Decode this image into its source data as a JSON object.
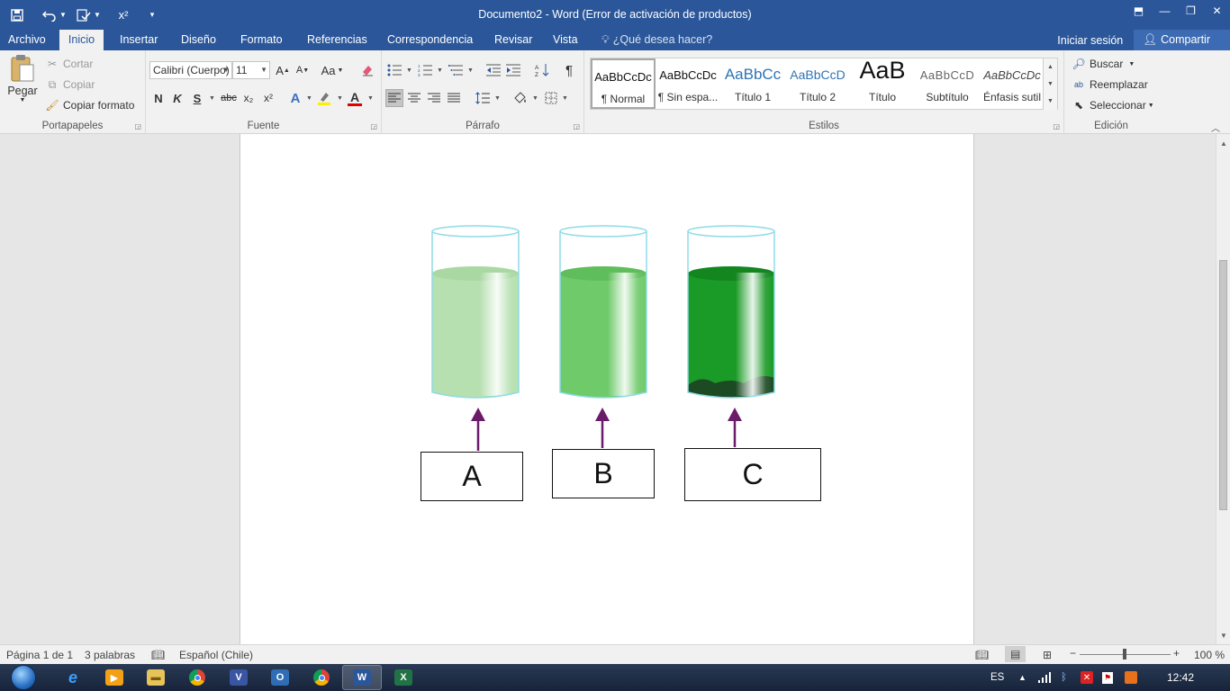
{
  "titlebar": {
    "title": "Documento2 - Word (Error de activación de productos)",
    "qat_icons": [
      "save-icon",
      "undo-icon",
      "customize-icon",
      "superscript-icon"
    ],
    "superscript_label": "x²"
  },
  "tabs": {
    "items": [
      "Archivo",
      "Inicio",
      "Insertar",
      "Diseño",
      "Formato",
      "Referencias",
      "Correspondencia",
      "Revisar",
      "Vista"
    ],
    "active": "Inicio",
    "tell_me": "¿Qué desea hacer?",
    "sign_in": "Iniciar sesión",
    "share": "Compartir"
  },
  "ribbon": {
    "clipboard": {
      "label": "Portapapeles",
      "paste": "Pegar",
      "cut": "Cortar",
      "copy": "Copiar",
      "format_painter": "Copiar formato"
    },
    "font": {
      "label": "Fuente",
      "font_name": "Calibri (Cuerpo)",
      "font_size": "11",
      "bold": "N",
      "italic": "K",
      "underline": "S",
      "strike": "abc",
      "subscript": "x₂",
      "superscript": "x²",
      "change_case": "Aa",
      "grow": "A",
      "shrink": "A"
    },
    "paragraph": {
      "label": "Párrafo",
      "pilcrow": "¶"
    },
    "styles": {
      "label": "Estilos",
      "items": [
        {
          "preview": "AaBbCcDc",
          "name": "¶ Normal"
        },
        {
          "preview": "AaBbCcDc",
          "name": "¶ Sin espa..."
        },
        {
          "preview": "AaBbCc",
          "name": "Título 1"
        },
        {
          "preview": "AaBbCcD",
          "name": "Título 2"
        },
        {
          "preview": "AaB",
          "name": "Título"
        },
        {
          "preview": "AaBbCcD",
          "name": "Subtítulo"
        },
        {
          "preview": "AaBbCcDc",
          "name": "Énfasis sutil"
        }
      ],
      "selected": 0
    },
    "editing": {
      "label": "Edición",
      "find": "Buscar",
      "replace": "Reemplazar",
      "select": "Seleccionar"
    }
  },
  "document": {
    "beakers": [
      {
        "label": "A",
        "liquid_color": "#b6e0b0",
        "liquid_shade": "#a9d8a3"
      },
      {
        "label": "B",
        "liquid_color": "#6fca6a",
        "liquid_shade": "#5fbd5b"
      },
      {
        "label": "C",
        "liquid_color": "#1a9a26",
        "liquid_shade": "#13861f",
        "sediment": true
      }
    ],
    "arrow_color": "#6a1b6a"
  },
  "statusbar": {
    "page": "Página 1 de 1",
    "words": "3 palabras",
    "language": "Español (Chile)",
    "zoom": "100 %"
  },
  "taskbar": {
    "lang": "ES",
    "time": "12:42",
    "apps": [
      "ie-icon",
      "media-player-icon",
      "explorer-icon",
      "chrome-icon",
      "visio-icon",
      "outlook-icon",
      "chrome-icon",
      "word-icon",
      "excel-icon"
    ]
  }
}
